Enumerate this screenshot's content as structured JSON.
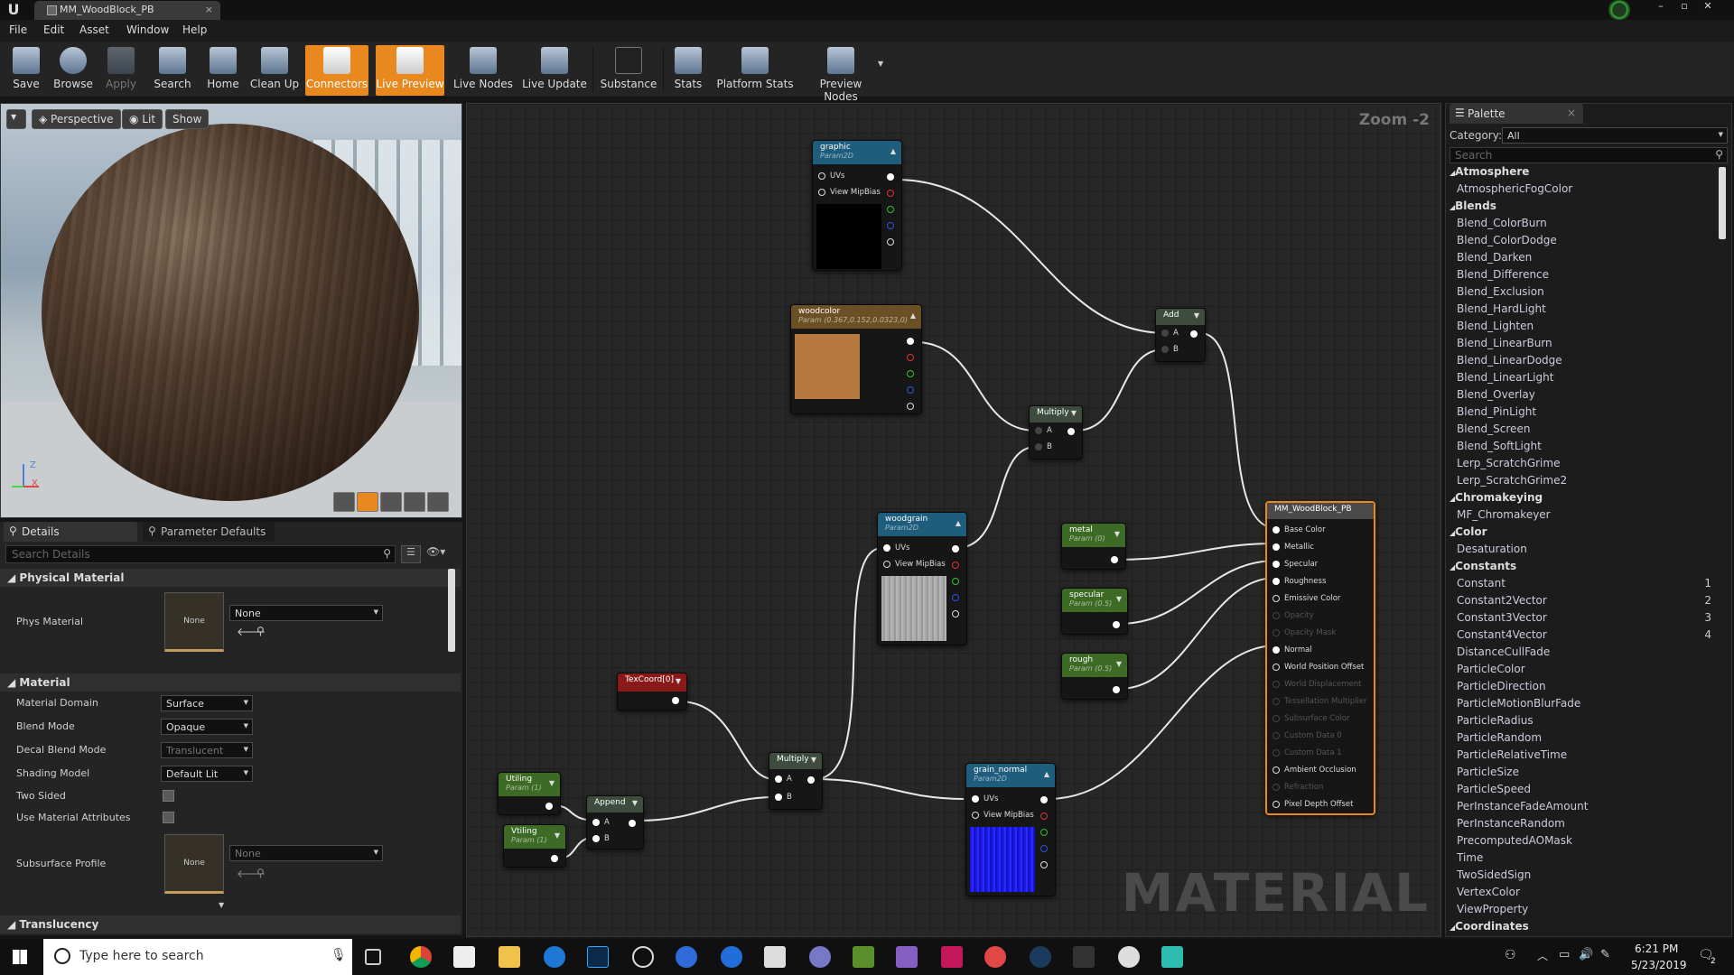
{
  "window": {
    "tab_title": "MM_WoodBlock_PB"
  },
  "menu": [
    "File",
    "Edit",
    "Asset",
    "Window",
    "Help"
  ],
  "toolbar": [
    "Save",
    "Browse",
    "Apply",
    "Search",
    "Home",
    "Clean Up",
    "Connectors",
    "Live Preview",
    "Live Nodes",
    "Live Update",
    "Substance",
    "Stats",
    "Platform Stats",
    "Preview Nodes"
  ],
  "viewport": {
    "perspective": "Perspective",
    "lit": "Lit",
    "show": "Show",
    "axis_z": "Z",
    "axis_x": "X"
  },
  "details": {
    "tab_details": "Details",
    "tab_params": "Parameter Defaults",
    "search_placeholder": "Search Details",
    "physical_section": "Physical Material",
    "phys_label": "Phys Material",
    "phys_value": "None",
    "phys_thumb": "None",
    "material_section": "Material",
    "domain_label": "Material Domain",
    "domain_value": "Surface",
    "blend_label": "Blend Mode",
    "blend_value": "Opaque",
    "decal_label": "Decal Blend Mode",
    "decal_value": "Translucent",
    "shading_label": "Shading Model",
    "shading_value": "Default Lit",
    "two_sided_label": "Two Sided",
    "use_attr_label": "Use Material Attributes",
    "subsurface_label": "Subsurface Profile",
    "subsurface_value": "None",
    "subsurface_thumb": "None",
    "translucency_section": "Translucency"
  },
  "graph": {
    "zoom": "Zoom -2",
    "watermark": "MATERIAL",
    "nodes": {
      "graphic": {
        "title": "graphic",
        "sub": "Param2D",
        "pins": [
          "UVs",
          "View MipBias"
        ]
      },
      "woodcolor": {
        "title": "woodcolor",
        "sub": "Param (0.367,0.152,0.0323,0)"
      },
      "add": {
        "title": "Add",
        "pins": [
          "A",
          "B"
        ]
      },
      "multiply1": {
        "title": "Multiply",
        "pins": [
          "A",
          "B"
        ]
      },
      "woodgrain": {
        "title": "woodgrain",
        "sub": "Param2D",
        "pins": [
          "UVs",
          "View MipBias"
        ]
      },
      "metal": {
        "title": "metal",
        "sub": "Param (0)"
      },
      "specular": {
        "title": "specular",
        "sub": "Param (0.5)"
      },
      "rough": {
        "title": "rough",
        "sub": "Param (0.5)"
      },
      "texcoord": {
        "title": "TexCoord[0]"
      },
      "multiply2": {
        "title": "Multiply",
        "pins": [
          "A",
          "B"
        ]
      },
      "utiling": {
        "title": "Utiling",
        "sub": "Param (1)"
      },
      "vtiling": {
        "title": "Vtiling",
        "sub": "Param (1)"
      },
      "append": {
        "title": "Append",
        "pins": [
          "A",
          "B"
        ]
      },
      "grain_normal": {
        "title": "grain_normal",
        "sub": "Param2D",
        "pins": [
          "UVs",
          "View MipBias"
        ]
      },
      "result": {
        "title": "MM_WoodBlock_PB",
        "pins": [
          "Base Color",
          "Metallic",
          "Specular",
          "Roughness",
          "Emissive Color",
          "Opacity",
          "Opacity Mask",
          "Normal",
          "World Position Offset",
          "World Displacement",
          "Tessellation Multiplier",
          "Subsurface Color",
          "Custom Data 0",
          "Custom Data 1",
          "Ambient Occlusion",
          "Refraction",
          "Pixel Depth Offset"
        ]
      }
    }
  },
  "palette": {
    "tab": "Palette",
    "category_label": "Category:",
    "category_value": "All",
    "search_placeholder": "Search",
    "rows": [
      {
        "t": "cat",
        "label": "Atmosphere"
      },
      {
        "t": "item",
        "label": "AtmosphericFogColor"
      },
      {
        "t": "cat",
        "label": "Blends"
      },
      {
        "t": "item",
        "label": "Blend_ColorBurn"
      },
      {
        "t": "item",
        "label": "Blend_ColorDodge"
      },
      {
        "t": "item",
        "label": "Blend_Darken"
      },
      {
        "t": "item",
        "label": "Blend_Difference"
      },
      {
        "t": "item",
        "label": "Blend_Exclusion"
      },
      {
        "t": "item",
        "label": "Blend_HardLight"
      },
      {
        "t": "item",
        "label": "Blend_Lighten"
      },
      {
        "t": "item",
        "label": "Blend_LinearBurn"
      },
      {
        "t": "item",
        "label": "Blend_LinearDodge"
      },
      {
        "t": "item",
        "label": "Blend_LinearLight"
      },
      {
        "t": "item",
        "label": "Blend_Overlay"
      },
      {
        "t": "item",
        "label": "Blend_PinLight"
      },
      {
        "t": "item",
        "label": "Blend_Screen"
      },
      {
        "t": "item",
        "label": "Blend_SoftLight"
      },
      {
        "t": "item",
        "label": "Lerp_ScratchGrime"
      },
      {
        "t": "item",
        "label": "Lerp_ScratchGrime2"
      },
      {
        "t": "cat",
        "label": "Chromakeying"
      },
      {
        "t": "item",
        "label": "MF_Chromakeyer"
      },
      {
        "t": "cat",
        "label": "Color"
      },
      {
        "t": "item",
        "label": "Desaturation"
      },
      {
        "t": "cat",
        "label": "Constants"
      },
      {
        "t": "item",
        "label": "Constant",
        "num": "1"
      },
      {
        "t": "item",
        "label": "Constant2Vector",
        "num": "2"
      },
      {
        "t": "item",
        "label": "Constant3Vector",
        "num": "3"
      },
      {
        "t": "item",
        "label": "Constant4Vector",
        "num": "4"
      },
      {
        "t": "item",
        "label": "DistanceCullFade"
      },
      {
        "t": "item",
        "label": "ParticleColor"
      },
      {
        "t": "item",
        "label": "ParticleDirection"
      },
      {
        "t": "item",
        "label": "ParticleMotionBlurFade"
      },
      {
        "t": "item",
        "label": "ParticleRadius"
      },
      {
        "t": "item",
        "label": "ParticleRandom"
      },
      {
        "t": "item",
        "label": "ParticleRelativeTime"
      },
      {
        "t": "item",
        "label": "ParticleSize"
      },
      {
        "t": "item",
        "label": "ParticleSpeed"
      },
      {
        "t": "item",
        "label": "PerInstanceFadeAmount"
      },
      {
        "t": "item",
        "label": "PerInstanceRandom"
      },
      {
        "t": "item",
        "label": "PrecomputedAOMask"
      },
      {
        "t": "item",
        "label": "Time"
      },
      {
        "t": "item",
        "label": "TwoSidedSign"
      },
      {
        "t": "item",
        "label": "VertexColor"
      },
      {
        "t": "item",
        "label": "ViewProperty"
      },
      {
        "t": "cat",
        "label": "Coordinates"
      }
    ]
  },
  "taskbar": {
    "search_placeholder": "Type here to search",
    "time": "6:21 PM",
    "date": "5/23/2019",
    "notif_count": "2"
  },
  "colors": {
    "accent": "#e8881e",
    "woodcolor": "#b5793d",
    "param2d_head": "#1f5d7d",
    "scalar_head": "#3d6b25",
    "add_head": "#3e4c3e",
    "texcoord_head": "#8a1a1a",
    "result_border": "#e8881e"
  }
}
